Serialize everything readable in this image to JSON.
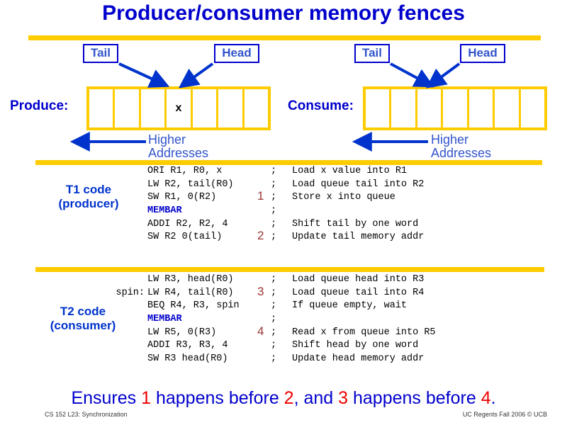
{
  "slide": {
    "title": "Producer/consumer memory fences",
    "conclusion": {
      "part1": "Ensures ",
      "n1": "1",
      "part2": " happens before ",
      "n2": "2",
      "part3": ",  and ",
      "n3": "3",
      "part4": " happens before ",
      "n4": "4",
      "part5": "."
    },
    "footer_left": "CS 152 L23: Synchronization",
    "footer_right": "UC Regents Fall 2006 © UCB"
  },
  "colors": {
    "title_blue": "#0000cc",
    "rule_yellow": "#ffcc00",
    "arrow_blue": "#0033cc",
    "marker_dark_red": "#993333",
    "conclusion_red": "#ee0000",
    "membar_blue": "#0000cc"
  },
  "diagrams": [
    {
      "id": "producer-queue",
      "label": "Produce:",
      "pointers": [
        {
          "name": "tail",
          "label": "Tail"
        },
        {
          "name": "head",
          "label": "Head"
        }
      ],
      "cells": [
        "",
        "",
        "",
        "x",
        "",
        "",
        ""
      ],
      "axis_label_line1": "Higher",
      "axis_label_line2": "Addresses"
    },
    {
      "id": "consumer-queue",
      "label": "Consume:",
      "pointers": [
        {
          "name": "tail",
          "label": "Tail"
        },
        {
          "name": "head",
          "label": "Head"
        }
      ],
      "cells": [
        "",
        "",
        "",
        "",
        "",
        "",
        ""
      ],
      "axis_label_line1": "Higher",
      "axis_label_line2": "Addresses"
    }
  ],
  "code_sections": [
    {
      "id": "t1",
      "title_line1": "T1 code",
      "title_line2": "(producer)",
      "rows": [
        {
          "label": "",
          "instr": "ORI R1, R0, x",
          "mark": "",
          "semi": ";",
          "comment": "Load x value into R1",
          "membar": false
        },
        {
          "label": "",
          "instr": "LW R2, tail(R0)",
          "mark": "",
          "semi": ";",
          "comment": "Load queue tail into R2",
          "membar": false
        },
        {
          "label": "",
          "instr": "SW R1, 0(R2)",
          "mark": "1",
          "semi": ";",
          "comment": "Store x into queue",
          "membar": false
        },
        {
          "label": "",
          "instr": "MEMBAR",
          "mark": "",
          "semi": ";",
          "comment": "",
          "membar": true
        },
        {
          "label": "",
          "instr": "ADDI R2, R2, 4",
          "mark": "",
          "semi": ";",
          "comment": "Shift tail by one word",
          "membar": false
        },
        {
          "label": "",
          "instr": "SW R2 0(tail)",
          "mark": "2",
          "semi": ";",
          "comment": "Update tail memory addr",
          "membar": false
        }
      ]
    },
    {
      "id": "t2",
      "title_line1": "T2 code",
      "title_line2": "(consumer)",
      "rows": [
        {
          "label": "",
          "instr": "LW R3, head(R0)",
          "mark": "",
          "semi": ";",
          "comment": "Load queue head into R3",
          "membar": false
        },
        {
          "label": "spin:",
          "instr": "LW R4, tail(R0)",
          "mark": "3",
          "semi": ";",
          "comment": "Load queue tail into R4",
          "membar": false
        },
        {
          "label": "",
          "instr": "BEQ R4, R3, spin",
          "mark": "",
          "semi": ";",
          "comment": "If queue empty, wait",
          "membar": false
        },
        {
          "label": "",
          "instr": "MEMBAR",
          "mark": "",
          "semi": ";",
          "comment": "",
          "membar": true
        },
        {
          "label": "",
          "instr": "LW R5, 0(R3)",
          "mark": "4",
          "semi": ";",
          "comment": "Read x from queue into R5",
          "membar": false
        },
        {
          "label": "",
          "instr": "ADDI R3, R3, 4",
          "mark": "",
          "semi": ";",
          "comment": "Shift head by one word",
          "membar": false
        },
        {
          "label": "",
          "instr": "SW R3 head(R0)",
          "mark": "",
          "semi": ";",
          "comment": "Update head memory addr",
          "membar": false
        }
      ]
    }
  ]
}
